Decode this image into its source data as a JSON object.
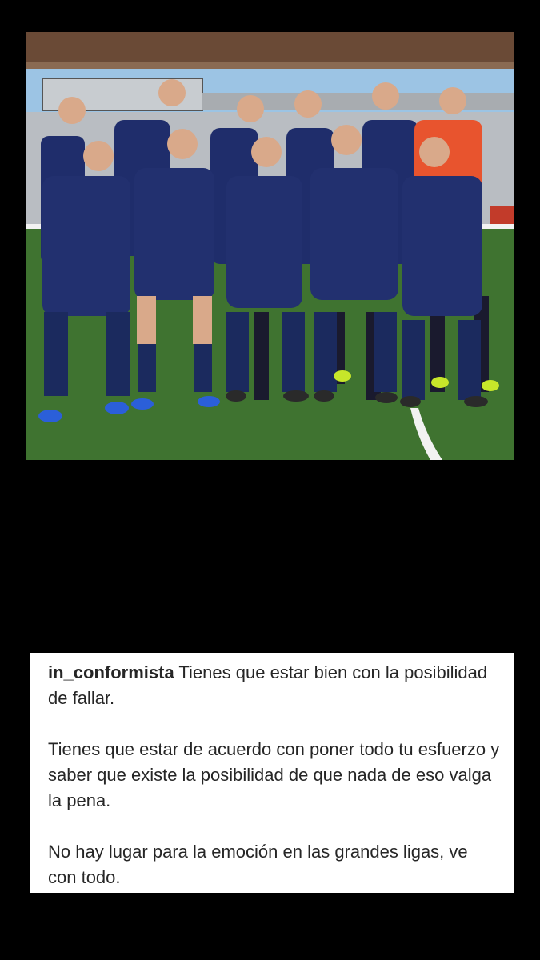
{
  "post": {
    "photo_icon": "team-photo-image",
    "photo_colors": {
      "grass": "#3d6d2c",
      "kit": "#1f2d6b",
      "keeper": "#e8542e"
    }
  },
  "caption": {
    "username": "in_conformista",
    "paragraphs": [
      "Tienes que estar bien con la posibilidad de fallar.",
      "Tienes que estar de acuerdo con poner todo tu esfuerzo y saber que existe la posibilidad de que nada de eso valga la pena.",
      "No hay lugar para la emoción en las grandes ligas, ve con todo."
    ]
  }
}
